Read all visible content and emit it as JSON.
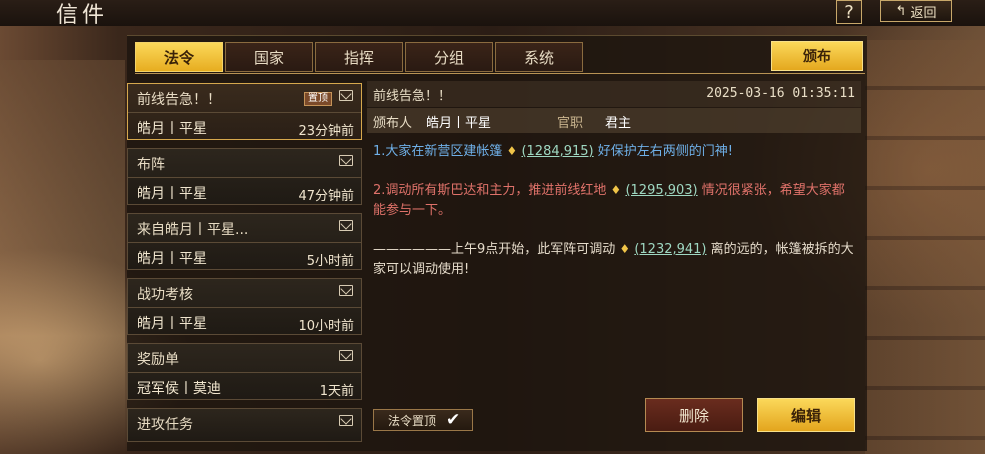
{
  "header": {
    "title": "信件",
    "help_label": "?",
    "back_label": "返回"
  },
  "tabs": [
    "法令",
    "国家",
    "指挥",
    "分组",
    "系统"
  ],
  "publish_label": "颁布",
  "list": [
    {
      "subject": "前线告急！！",
      "pin_tag": "置顶",
      "sender": "皓月丨平星",
      "time": "23分钟前"
    },
    {
      "subject": "布阵",
      "sender": "皓月丨平星",
      "time": "47分钟前"
    },
    {
      "subject": "来自皓月丨平星...",
      "sender": "皓月丨平星",
      "time": "5小时前"
    },
    {
      "subject": "战功考核",
      "sender": "皓月丨平星",
      "time": "10小时前"
    },
    {
      "subject": "奖励单",
      "sender": "冠军侯丨莫迪",
      "time": "1天前"
    },
    {
      "subject": "进攻任务"
    }
  ],
  "detail": {
    "subject": "前线告急！！",
    "date": "2025-03-16 01:35:11",
    "publisher_label": "颁布人",
    "publisher": "皓月丨平星",
    "rank_label": "官职",
    "rank": "君主",
    "p1_a": "1.大家在新营区建帐篷",
    "p1_coord": "(1284,915)",
    "p1_b": "好保护左右两侧的门神!",
    "p2_a": "2.调动所有斯巴达和主力，推进前线红地",
    "p2_coord": "(1295,903)",
    "p2_b": "情况很紧张，希望大家都能参与一下。",
    "p3_a": "——————上午9点开始，此军阵可调动",
    "p3_coord": "(1232,941)",
    "p3_b": "离的远的，帐篷被拆的大家可以调动使用!"
  },
  "pin_toggle_label": "法令置顶",
  "delete_label": "删除",
  "edit_label": "编辑",
  "icons": {
    "location": "location-pin-icon",
    "envelope": "envelope-open-icon",
    "check": "check-icon",
    "back": "back-arrow-icon"
  }
}
